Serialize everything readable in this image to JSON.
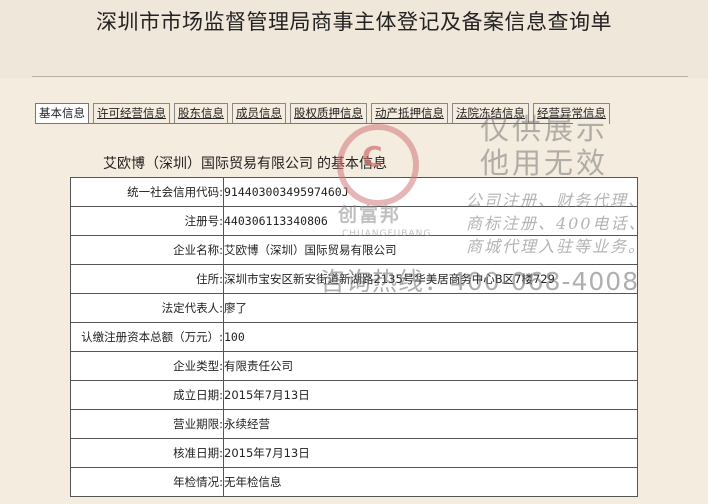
{
  "page_title": "深圳市市场监督管理局商事主体登记及备案信息查询单",
  "tabs": [
    {
      "label": "基本信息",
      "active": true
    },
    {
      "label": "许可经营信息"
    },
    {
      "label": "股东信息"
    },
    {
      "label": "成员信息"
    },
    {
      "label": "股权质押信息"
    },
    {
      "label": "动产抵押信息"
    },
    {
      "label": "法院冻结信息"
    },
    {
      "label": "经营异常信息"
    }
  ],
  "company_heading": {
    "name": "艾欧博（深圳）国际贸易有限公司",
    "suffix": "的基本信息"
  },
  "rows": [
    {
      "label": "统一社会信用代码:",
      "value": "91440300349597460J"
    },
    {
      "label": "注册号:",
      "value": "440306113340806"
    },
    {
      "label": "企业名称:",
      "value": "艾欧博（深圳）国际贸易有限公司"
    },
    {
      "label": "住所:",
      "value": "深圳市宝安区新安街道新湖路2135号华美居商务中心B区7楼729"
    },
    {
      "label": "法定代表人:",
      "value": "廖了"
    },
    {
      "label": "认缴注册资本总额（万元）:",
      "value": "100"
    },
    {
      "label": "企业类型:",
      "value": "有限责任公司"
    },
    {
      "label": "成立日期:",
      "value": "2015年7月13日"
    },
    {
      "label": "营业期限:",
      "value": "永续经营"
    },
    {
      "label": "核准日期:",
      "value": "2015年7月13日"
    },
    {
      "label": "年检情况:",
      "value": "无年检信息"
    }
  ],
  "watermark": {
    "logo_glyph": "C",
    "logo_name": "创富邦",
    "logo_pinyin": "CHUANGFUBANG",
    "big_lines": [
      "仅供展示",
      "他用无效"
    ],
    "small_lines": [
      "公司注册、财务代理、",
      "商标注册、400电话、",
      "商城代理入驻等业务。"
    ],
    "hotline": "咨询热线：400-068-4008"
  }
}
